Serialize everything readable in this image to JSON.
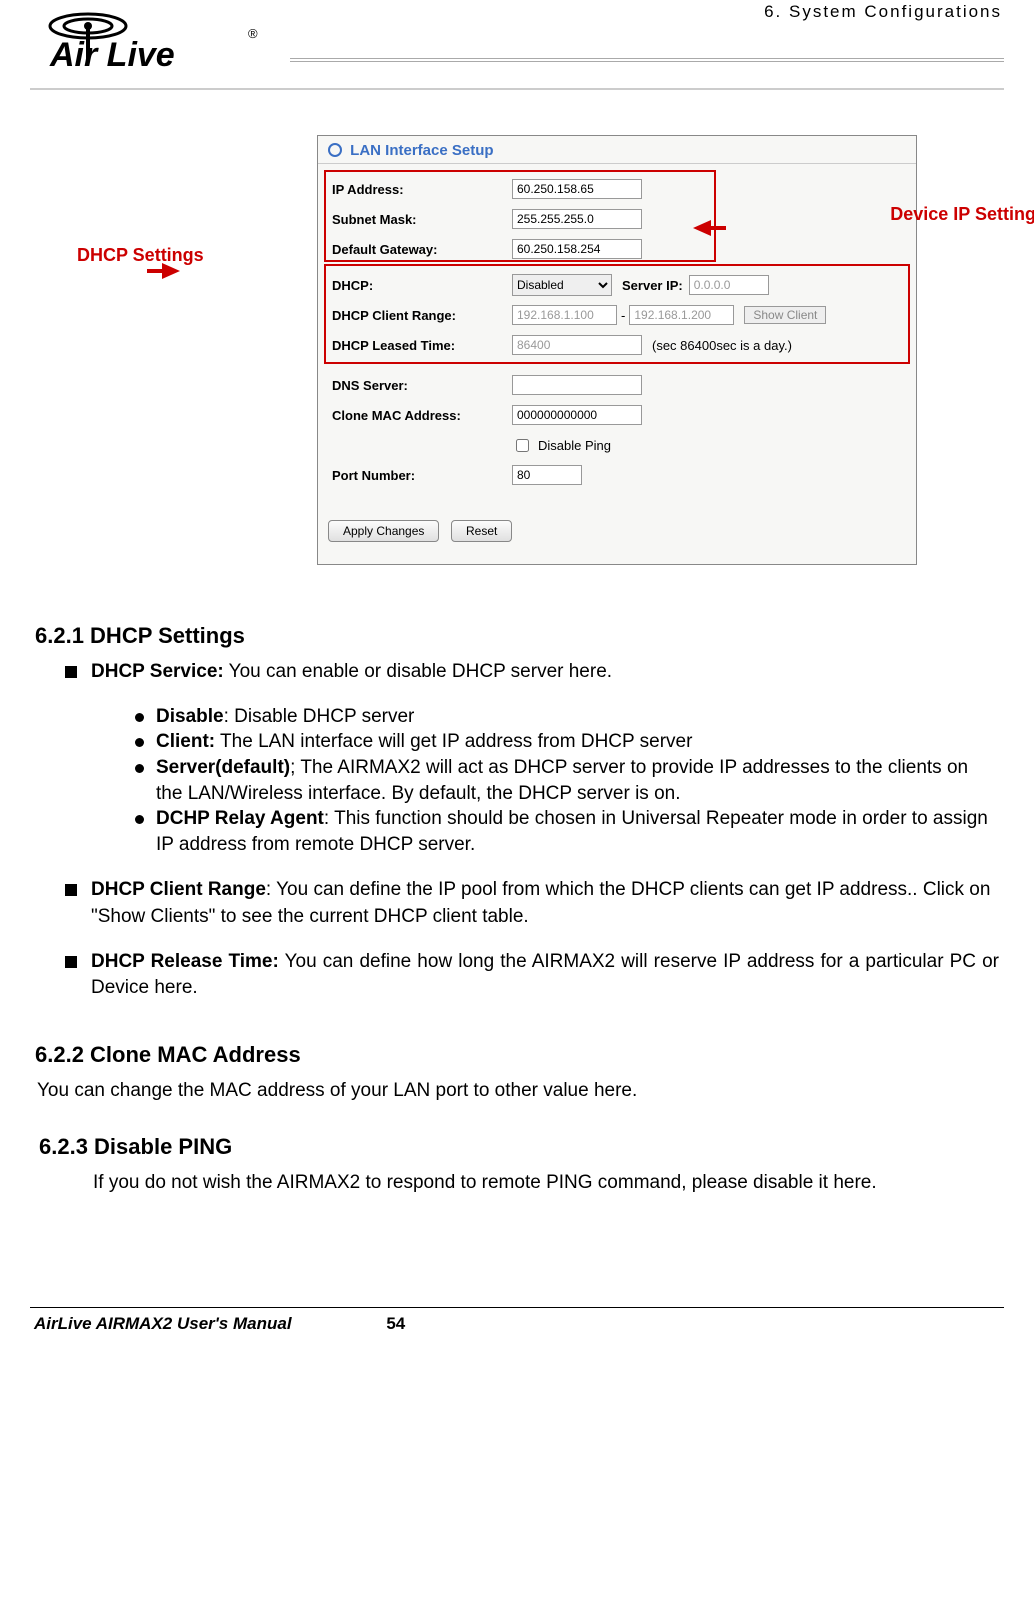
{
  "chapter_label": "6.  System  Configurations",
  "logo_text": "Air Live",
  "callouts": {
    "device_ip": "Device IP Settings",
    "dhcp": "DHCP Settings"
  },
  "panel": {
    "title": "LAN Interface Setup",
    "labels": {
      "ip": "IP Address:",
      "subnet": "Subnet Mask:",
      "gateway": "Default Gateway:",
      "dhcp": "DHCP:",
      "serverip": "Server IP:",
      "range": "DHCP Client Range:",
      "leased": "DHCP Leased Time:",
      "dns": "DNS Server:",
      "clone": "Clone MAC Address:",
      "disping": "Disable Ping",
      "port": "Port Number:"
    },
    "values": {
      "ip": "60.250.158.65",
      "subnet": "255.255.255.0",
      "gateway": "60.250.158.254",
      "dhcp_sel": "Disabled",
      "serverip": "0.0.0.0",
      "range1": "192.168.1.100",
      "range_sep": "-",
      "range2": "192.168.1.200",
      "leased": "86400",
      "leased_hint": "(sec 86400sec is a day.)",
      "dns": "",
      "clone": "000000000000",
      "port": "80",
      "show_client": "Show Client"
    },
    "buttons": {
      "apply": "Apply Changes",
      "reset": "Reset"
    }
  },
  "sections": {
    "s621_title": "6.2.1 DHCP Settings",
    "dhcp_service_b": "DHCP Service:",
    "dhcp_service_t": "   You can enable or disable DHCP server here.",
    "opts": {
      "disable_b": "Disable",
      "disable_t": ":   Disable DHCP server",
      "client_b": "Client:",
      "client_t": "   The LAN interface will get IP address from DHCP server",
      "server_b": "Server(default)",
      "server_t": ";   The AIRMAX2 will act as DHCP server to provide IP addresses to the clients on the LAN/Wireless interface.   By default, the DHCP server is on.",
      "relay_b": "DCHP Relay Agent",
      "relay_t": ":   This function should be chosen in Universal Repeater mode in order to assign IP address from remote DHCP server."
    },
    "range_b": "DHCP Client Range",
    "range_t": ": You can define the IP pool from which the DHCP clients can get IP address.. Click on \"Show Clients\" to see the current DHCP client table.",
    "release_b": "DHCP Release Time:",
    "release_t": "   You can define how long the AIRMAX2 will reserve IP address for a particular PC or Device here.",
    "s622_title": "6.2.2 Clone MAC Address",
    "s622_text": "You can change the MAC address of your LAN port to other value here.",
    "s623_title": "6.2.3 Disable PING",
    "s623_text": "If you do not wish the AIRMAX2 to respond to remote PING command, please disable it here."
  },
  "footer": {
    "left": "AirLive AIRMAX2 User's Manual",
    "page": "54"
  }
}
